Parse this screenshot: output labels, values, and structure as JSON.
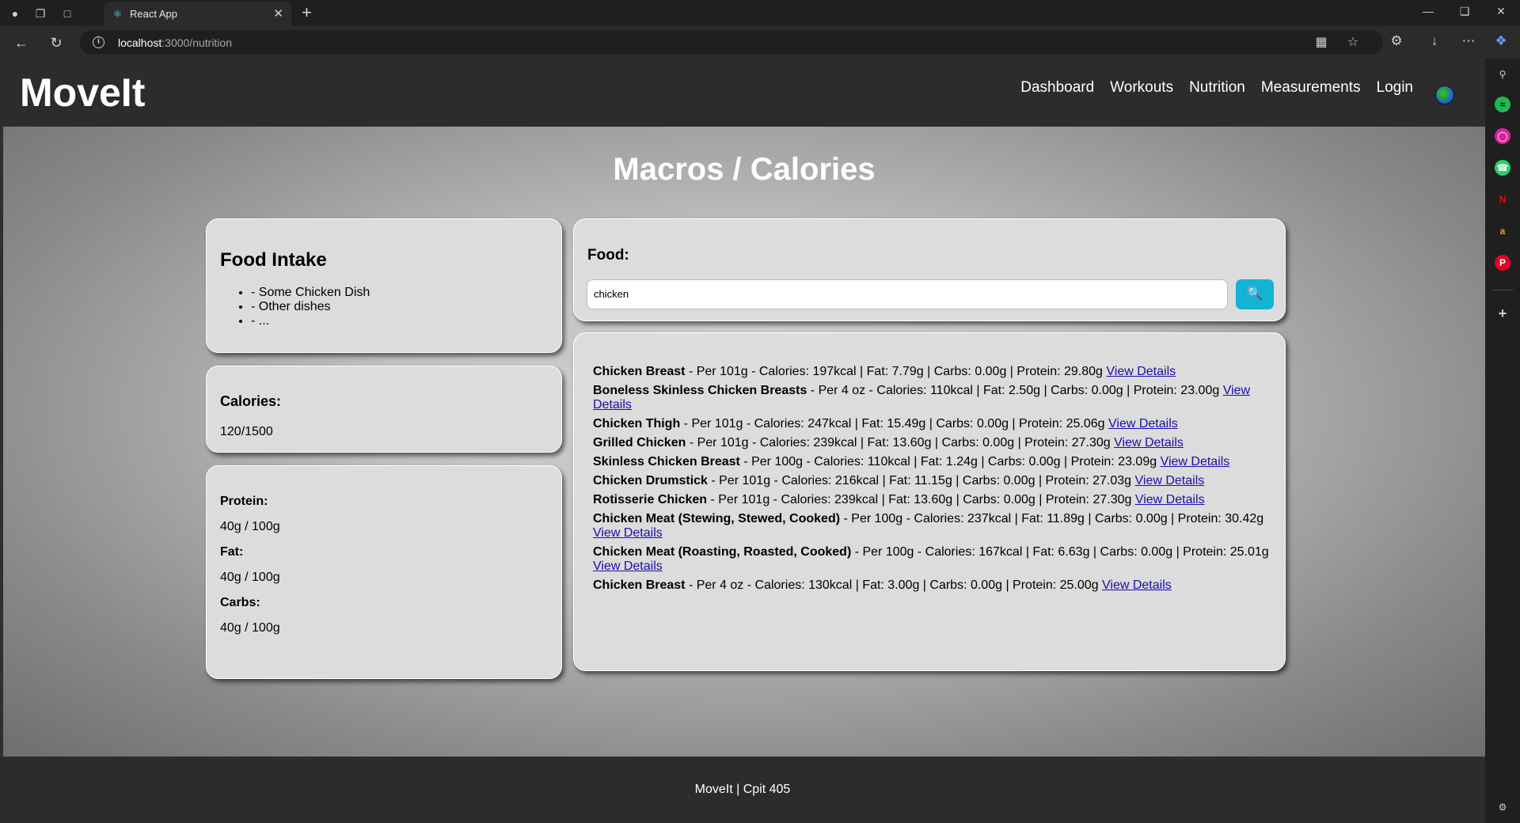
{
  "browser": {
    "tab_title": "React App",
    "url_host": "localhost",
    "url_path": ":3000/nutrition"
  },
  "app": {
    "logo": "MoveIt",
    "nav": [
      "Dashboard",
      "Workouts",
      "Nutrition",
      "Measurements",
      "Login"
    ]
  },
  "page": {
    "title": "Macros / Calories"
  },
  "intake": {
    "title": "Food Intake",
    "items": [
      "- Some Chicken Dish",
      "- Other dishes",
      "- ..."
    ]
  },
  "calories": {
    "label": "Calories:",
    "value": "120/1500"
  },
  "macros": {
    "protein_label": "Protein:",
    "protein_value": "40g / 100g",
    "fat_label": "Fat:",
    "fat_value": "40g / 100g",
    "carbs_label": "Carbs:",
    "carbs_value": "40g / 100g"
  },
  "food_search": {
    "label": "Food:",
    "value": "chicken",
    "button_icon": "search-icon"
  },
  "results": [
    {
      "name": "Chicken Breast",
      "details": " - Per 101g - Calories: 197kcal | Fat: 7.79g | Carbs: 0.00g | Protein: 29.80g ",
      "link": "View Details"
    },
    {
      "name": "Boneless Skinless Chicken Breasts",
      "details": " - Per 4 oz - Calories: 110kcal | Fat: 2.50g | Carbs: 0.00g | Protein: 23.00g ",
      "link": "View Details"
    },
    {
      "name": "Chicken Thigh",
      "details": " - Per 101g - Calories: 247kcal | Fat: 15.49g | Carbs: 0.00g | Protein: 25.06g ",
      "link": "View Details"
    },
    {
      "name": "Grilled Chicken",
      "details": " - Per 101g - Calories: 239kcal | Fat: 13.60g | Carbs: 0.00g | Protein: 27.30g ",
      "link": "View Details"
    },
    {
      "name": "Skinless Chicken Breast",
      "details": " - Per 100g - Calories: 110kcal | Fat: 1.24g | Carbs: 0.00g | Protein: 23.09g ",
      "link": "View Details"
    },
    {
      "name": "Chicken Drumstick",
      "details": " - Per 101g - Calories: 216kcal | Fat: 11.15g | Carbs: 0.00g | Protein: 27.03g ",
      "link": "View Details"
    },
    {
      "name": "Rotisserie Chicken",
      "details": " - Per 101g - Calories: 239kcal | Fat: 13.60g | Carbs: 0.00g | Protein: 27.30g ",
      "link": "View Details"
    },
    {
      "name": "Chicken Meat (Stewing, Stewed, Cooked)",
      "details": " - Per 100g - Calories: 237kcal | Fat: 11.89g | Carbs: 0.00g | Protein: 30.42g ",
      "link": "View Details"
    },
    {
      "name": "Chicken Meat (Roasting, Roasted, Cooked)",
      "details": " - Per 100g - Calories: 167kcal | Fat: 6.63g | Carbs: 0.00g | Protein: 25.01g ",
      "link": "View Details"
    },
    {
      "name": "Chicken Breast",
      "details": " - Per 4 oz - Calories: 130kcal | Fat: 3.00g | Carbs: 0.00g | Protein: 25.00g ",
      "link": "View Details"
    }
  ],
  "footer": {
    "text": "MoveIt | Cpit 405"
  },
  "colors": {
    "search_button": "#13b3d6",
    "link": "#1a0dab",
    "header_bg": "#2c2c2c"
  }
}
